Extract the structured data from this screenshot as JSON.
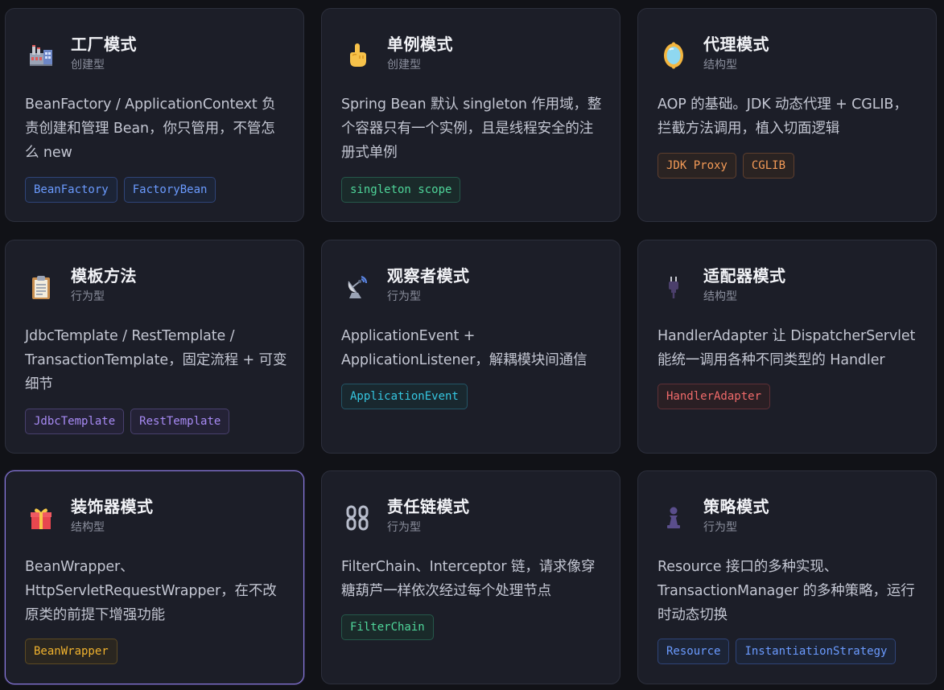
{
  "cards": [
    {
      "icon": "factory-icon",
      "title": "工厂模式",
      "category": "创建型",
      "description": "BeanFactory / ApplicationContext 负责创建和管理 Bean，你只管用，不管怎么 new",
      "tags": [
        {
          "label": "BeanFactory",
          "color": "#6b9bff"
        },
        {
          "label": "FactoryBean",
          "color": "#6b9bff"
        }
      ]
    },
    {
      "icon": "pointing-finger-icon",
      "title": "单例模式",
      "category": "创建型",
      "description": "Spring Bean 默认 singleton 作用域，整个容器只有一个实例，且是线程安全的注册式单例",
      "tags": [
        {
          "label": "singleton scope",
          "color": "#4fd69a"
        }
      ]
    },
    {
      "icon": "mirror-icon",
      "title": "代理模式",
      "category": "结构型",
      "description": "AOP 的基础。JDK 动态代理 + CGLIB，拦截方法调用，植入切面逻辑",
      "tags": [
        {
          "label": "JDK Proxy",
          "color": "#f59b57"
        },
        {
          "label": "CGLIB",
          "color": "#f59b57"
        }
      ]
    },
    {
      "icon": "clipboard-icon",
      "title": "模板方法",
      "category": "行为型",
      "description": "JdbcTemplate / RestTemplate / TransactionTemplate，固定流程 + 可变细节",
      "tags": [
        {
          "label": "JdbcTemplate",
          "color": "#a88bf5"
        },
        {
          "label": "RestTemplate",
          "color": "#a88bf5"
        }
      ]
    },
    {
      "icon": "satellite-dish-icon",
      "title": "观察者模式",
      "category": "行为型",
      "description": "ApplicationEvent + ApplicationListener，解耦模块间通信",
      "tags": [
        {
          "label": "ApplicationEvent",
          "color": "#35c6e0"
        }
      ]
    },
    {
      "icon": "plug-icon",
      "title": "适配器模式",
      "category": "结构型",
      "description": "HandlerAdapter 让 DispatcherServlet 能统一调用各种不同类型的 Handler",
      "tags": [
        {
          "label": "HandlerAdapter",
          "color": "#f06a6a"
        }
      ]
    },
    {
      "icon": "gift-icon",
      "title": "装饰器模式",
      "category": "结构型",
      "description": "BeanWrapper、HttpServletRequestWrapper，在不改原类的前提下增强功能",
      "tags": [
        {
          "label": "BeanWrapper",
          "color": "#f0b22e"
        }
      ]
    },
    {
      "icon": "chain-icon",
      "title": "责任链模式",
      "category": "行为型",
      "description": "FilterChain、Interceptor 链，请求像穿糖葫芦一样依次经过每个处理节点",
      "tags": [
        {
          "label": "FilterChain",
          "color": "#4fd69a"
        }
      ]
    },
    {
      "icon": "chess-pawn-icon",
      "title": "策略模式",
      "category": "行为型",
      "description": "Resource 接口的多种实现、TransactionManager 的多种策略，运行时动态切换",
      "tags": [
        {
          "label": "Resource",
          "color": "#6b9bff"
        },
        {
          "label": "InstantiationStrategy",
          "color": "#6b9bff"
        }
      ]
    }
  ]
}
